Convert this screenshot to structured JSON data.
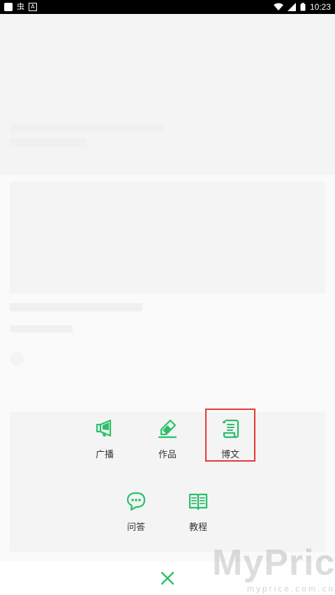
{
  "status_bar": {
    "time": "10:23",
    "left_icons": [
      "app-square-icon",
      "bug-icon",
      "a-badge-icon"
    ],
    "right_icons": [
      "wifi-icon",
      "signal-icon",
      "battery-icon"
    ]
  },
  "accent_color": "#2bbf6a",
  "menu": {
    "row1": [
      {
        "label": "广播",
        "icon": "megaphone-icon"
      },
      {
        "label": "作品",
        "icon": "pen-icon"
      },
      {
        "label": "博文",
        "icon": "scroll-icon"
      }
    ],
    "row2": [
      {
        "label": "问答",
        "icon": "chat-bubble-icon"
      },
      {
        "label": "教程",
        "icon": "book-icon"
      }
    ]
  },
  "close_icon": "close-icon",
  "watermark": {
    "main": "MyPrice",
    "sub": "myprice.com.cn"
  }
}
